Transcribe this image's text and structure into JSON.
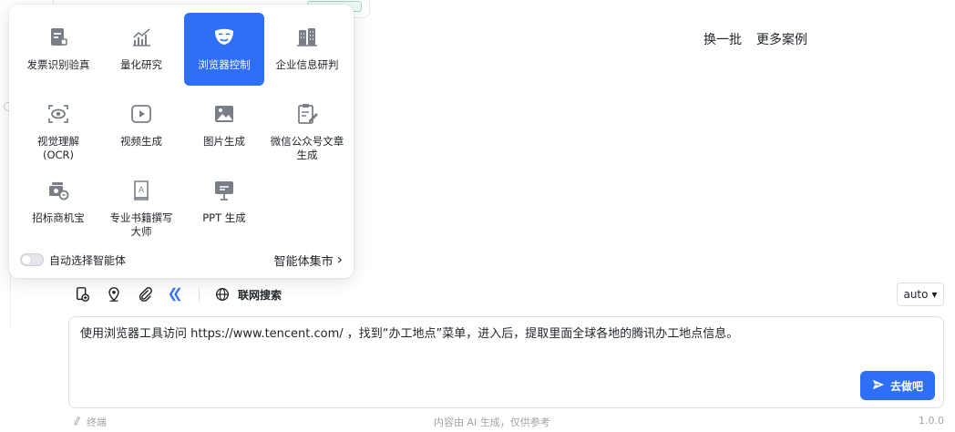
{
  "case_actions": {
    "refresh": "换一批",
    "more_cases": "更多案例"
  },
  "agents": [
    {
      "label": "发票识别验真",
      "icon": "invoice-icon",
      "active": false
    },
    {
      "label": "量化研究",
      "icon": "chart-trend-icon",
      "active": false
    },
    {
      "label": "浏览器控制",
      "icon": "mask-icon",
      "active": true
    },
    {
      "label": "企业信息研判",
      "icon": "buildings-icon",
      "active": false
    },
    {
      "label": "视觉理解\n(OCR)",
      "icon": "scan-eye-icon",
      "active": false
    },
    {
      "label": "视频生成",
      "icon": "video-icon",
      "active": false
    },
    {
      "label": "图片生成",
      "icon": "image-icon",
      "active": false
    },
    {
      "label": "微信公众号文章\n生成",
      "icon": "edit-document-icon",
      "active": false
    },
    {
      "label": "招标商机宝",
      "icon": "money-icon",
      "active": false
    },
    {
      "label": "专业书籍撰写\n大师",
      "icon": "book-icon",
      "active": false
    },
    {
      "label": "PPT 生成",
      "icon": "presentation-icon",
      "active": false
    }
  ],
  "popup_footer": {
    "auto_select_label": "自动选择智能体",
    "market_label": "智能体集市",
    "market_chevron": "›"
  },
  "toolbar": {
    "web_search_label": "联网搜索"
  },
  "model_select": {
    "value": "auto",
    "arrow": "▾"
  },
  "input": {
    "value": "使用浏览器工具访问 https://www.tencent.com/ ，找到“办工地点”菜单，进入后，提取里面全球各地的腾讯办工地点信息。"
  },
  "go_button": {
    "label": "去做吧"
  },
  "footer": {
    "left": "终端",
    "center": "内容由 AI 生成，仅供参考",
    "version": "1.0.0"
  },
  "colors": {
    "accent": "#2f6ef6",
    "icon_gray": "#7a7f87"
  }
}
